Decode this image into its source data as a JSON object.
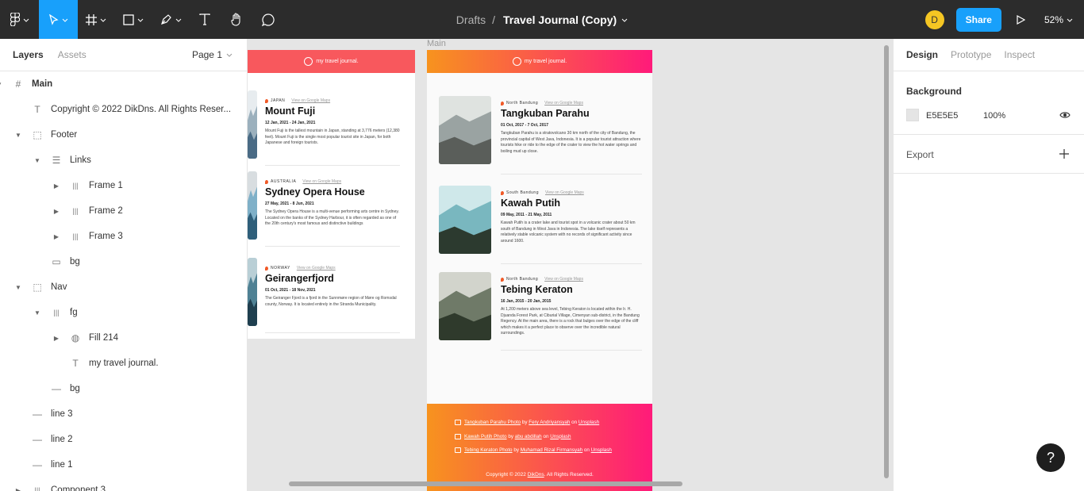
{
  "toolbar": {
    "breadcrumb_drafts": "Drafts",
    "breadcrumb_sep": "/",
    "file_name": "Travel Journal (Copy)",
    "avatar_initial": "D",
    "share_label": "Share",
    "zoom_level": "52%"
  },
  "left_panel": {
    "tab_layers": "Layers",
    "tab_assets": "Assets",
    "page": "Page 1",
    "layers": [
      {
        "label": "Main",
        "icon": "frame-icon"
      },
      {
        "label": "Copyright © 2022 DikDns. All Rights Reser...",
        "icon": "text-icon"
      },
      {
        "label": "Footer",
        "icon": "dashed-frame-icon"
      },
      {
        "label": "Links",
        "icon": "vertical-layout-icon"
      },
      {
        "label": "Frame 1",
        "icon": "horizontal-layout-icon"
      },
      {
        "label": "Frame 2",
        "icon": "horizontal-layout-icon"
      },
      {
        "label": "Frame 3",
        "icon": "horizontal-layout-icon"
      },
      {
        "label": "bg",
        "icon": "rectangle-icon"
      },
      {
        "label": "Nav",
        "icon": "dashed-frame-icon"
      },
      {
        "label": "fg",
        "icon": "horizontal-layout-icon"
      },
      {
        "label": "Fill 214",
        "icon": "globe-icon"
      },
      {
        "label": "my travel journal.",
        "icon": "text-icon"
      },
      {
        "label": "bg",
        "icon": "line-icon"
      },
      {
        "label": "line 3",
        "icon": "line-icon"
      },
      {
        "label": "line 2",
        "icon": "line-icon"
      },
      {
        "label": "line 1",
        "icon": "line-icon"
      },
      {
        "label": "Component 3",
        "icon": "horizontal-layout-icon"
      }
    ]
  },
  "canvas": {
    "frame_label": "Main",
    "brand": "my travel journal.",
    "view_maps": "View on Google Maps",
    "frame_a": [
      {
        "location": "JAPAN",
        "title": "Mount Fuji",
        "dates": "12 Jan, 2021 - 24 Jan, 2021",
        "desc": "Mount Fuji is the tallest mountain in Japan, standing at 3,776 meters (12,380 feet). Mount Fuji is the single most popular tourist site in Japan, for both Japanese and foreign tourists."
      },
      {
        "location": "AUSTRALIA",
        "title": "Sydney Opera House",
        "dates": "27 May, 2021 - 8 Jun, 2021",
        "desc": "The Sydney Opera House is a multi-venue performing arts centre in Sydney. Located on the banks of the Sydney Harbour, it is often regarded as one of the 20th century's most famous and distinctive buildings"
      },
      {
        "location": "NORWAY",
        "title": "Geirangerfjord",
        "dates": "01 Oct, 2021 - 18 Nov, 2021",
        "desc": "The Geiranger Fjord is a fjord in the Sunnmøre region of Møre og Romsdal county, Norway. It is located entirely in the Stranda Municipality."
      }
    ],
    "frame_b": [
      {
        "location": "North Bandung",
        "title": "Tangkuban Parahu",
        "dates": "01 Oct, 2017 - 7 Oct, 2017",
        "desc": "Tangkuban Parahu is a stratovolcano 30 km north of the city of Bandung, the provincial capital of West Java, Indonesia. It is a popular tourist attraction where tourists hike or ride to the edge of the crater to view the hot water springs and boiling mud up close."
      },
      {
        "location": "South Bandung",
        "title": "Kawah Putih",
        "dates": "09 May, 2011 - 21 May, 2011",
        "desc": "Kawah Putih is a crater lake and tourist spot in a volcanic crater about 50 km south of Bandung in West Java in Indonesia. The lake itself represents a relatively stable volcanic system with no records of significant activity since around 1600."
      },
      {
        "location": "North Bandung",
        "title": "Tebing Keraton",
        "dates": "16 Jan, 2015 - 20 Jan, 2015",
        "desc": "At 1,200 meters above sea level, Tebing Keraton is located within the Ir. H. Djuanda Forest Park, at Ciburial Village, Cimenyan sub-district, in the Bandung Regency. At the main area, there is a rock that bulges over the edge of the cliff which makes it a perfect place to observe over the incredible natural surroundings."
      }
    ],
    "credits": [
      {
        "photo": "Tangkuban Parahu Photo",
        "by": "by",
        "author": "Fery Andriyansyah",
        "on": "on",
        "site": "Unsplash"
      },
      {
        "photo": "Kawah Putih Photo",
        "by": "by",
        "author": "abu abdillah",
        "on": "on",
        "site": "Unsplash"
      },
      {
        "photo": "Tebing Keraton Photo",
        "by": "by",
        "author": "Muhamad Rizal Firmansyah",
        "on": "on",
        "site": "Unsplash"
      }
    ],
    "copyright_pre": "Copyright © 2022",
    "copyright_link": "DikDns",
    "copyright_post": ". All Rights Reserved."
  },
  "right_panel": {
    "tab_design": "Design",
    "tab_prototype": "Prototype",
    "tab_inspect": "Inspect",
    "background_title": "Background",
    "bg_hex": "E5E5E5",
    "bg_opacity": "100%",
    "export_title": "Export",
    "bg_color": "#e5e5e5"
  },
  "help_label": "?"
}
